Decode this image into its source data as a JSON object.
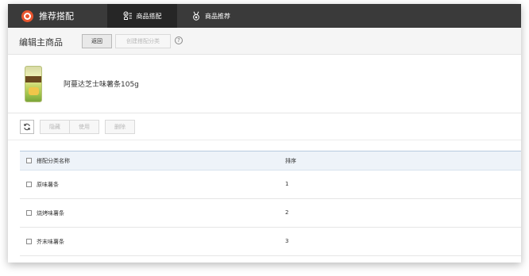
{
  "app": {
    "title": "推荐搭配"
  },
  "nav": {
    "tabs": [
      {
        "label": "商品搭配",
        "icon": "list-check-icon",
        "active": true
      },
      {
        "label": "商品推荐",
        "icon": "medal-icon",
        "active": false
      }
    ]
  },
  "header": {
    "title": "编辑主商品",
    "back_label": "返回",
    "create_label": "创建搭配分类",
    "help_glyph": "?"
  },
  "product": {
    "name": "阿蔓达芝士味薯条105g"
  },
  "toolbar": {
    "refresh_icon": "refresh-icon",
    "hide_label": "隐藏",
    "use_label": "使用",
    "delete_label": "删除"
  },
  "table": {
    "columns": [
      "搭配分类名称",
      "排序"
    ],
    "rows": [
      {
        "name": "原味薯条",
        "sort": "1"
      },
      {
        "name": "烧烤味薯条",
        "sort": "2"
      },
      {
        "name": "芥末味薯条",
        "sort": "3"
      }
    ]
  },
  "colors": {
    "topbar": "#3a3a3a",
    "active_tab": "#262626",
    "brand_logo": "#e8552e",
    "table_header": "#eef3f9"
  }
}
